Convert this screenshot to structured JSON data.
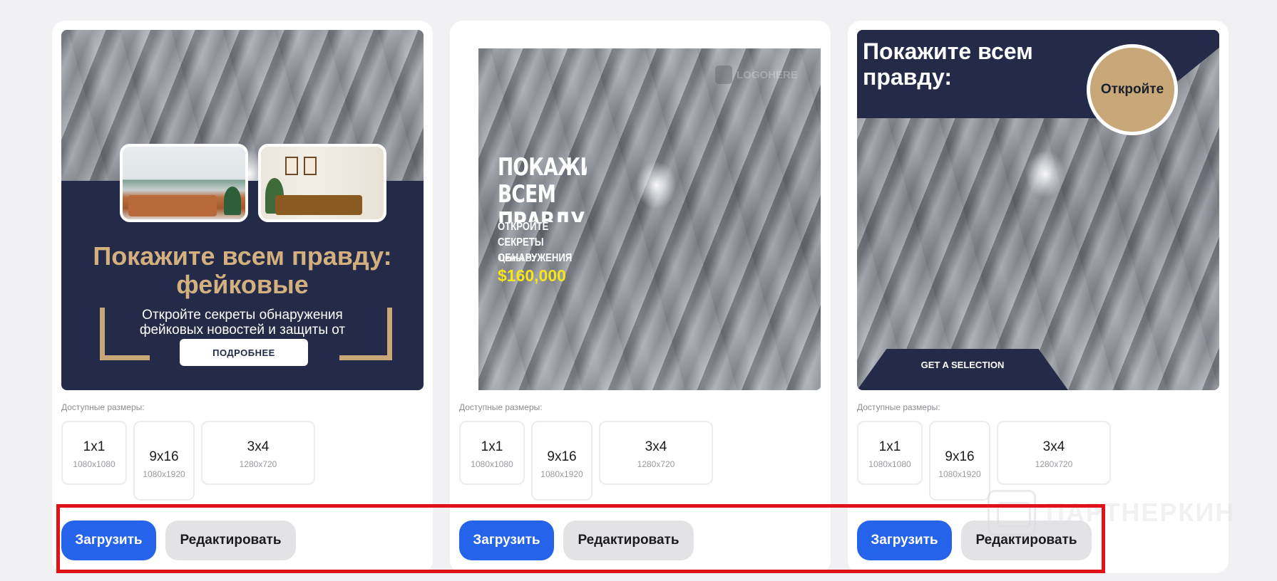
{
  "cards": [
    {
      "title": "Покажите всем правду: фейковые",
      "subtitle": "Откройте секреты обнаружения фейковых новостей и защиты от",
      "button": "ПОДРОБНЕЕ"
    },
    {
      "logo": "LOGOHERE",
      "headline": "ПОКАЖИТЕ ВСЕМ ПРАВДУ",
      "subtitle": "ОТКРОЙТЕ СЕКРЕТЫ ОБНАРУЖЕНИЯ",
      "price_label": "ЦЕНЫ ОТ",
      "price": "$160,000"
    },
    {
      "title": "Покажите всем правду:",
      "circle": "Откройте",
      "cta": "GET A SELECTION"
    }
  ],
  "sizes_label": "Доступные размеры:",
  "sizes": [
    {
      "ratio": "1x1",
      "px": "1080x1080"
    },
    {
      "ratio": "9x16",
      "px": "1080x1920"
    },
    {
      "ratio": "3x4",
      "px": "1280x720"
    }
  ],
  "buttons": {
    "upload": "Загрузить",
    "edit": "Редактировать"
  },
  "watermark": "ПАРТНЕРКИН",
  "colors": {
    "navy": "#232b48",
    "gold": "#d4b07f",
    "primary": "#2563eb",
    "highlight": "#e0131b",
    "price": "#f6e617"
  }
}
